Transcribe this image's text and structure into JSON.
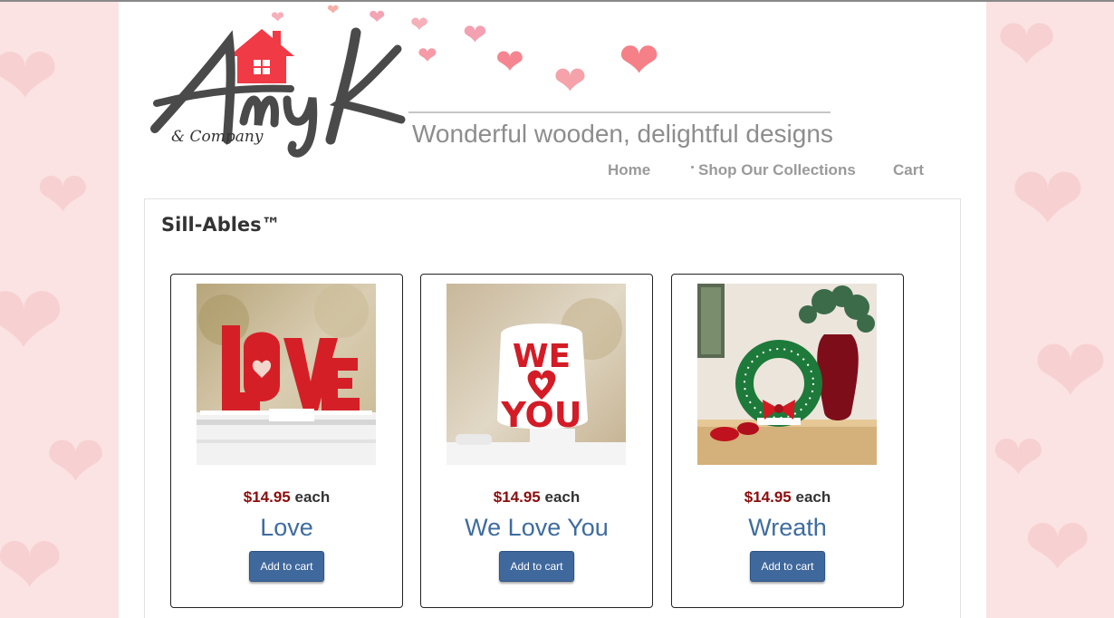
{
  "brand": {
    "logo_text": "Amy K",
    "logo_sub": "& Company",
    "tagline": "Wonderful wooden, delightful designs"
  },
  "nav": {
    "items": [
      "Home",
      "Shop Our Collections",
      "Cart"
    ]
  },
  "section": {
    "title": "Sill-Ables™"
  },
  "products": [
    {
      "price": "$14.95",
      "each": "each",
      "name": "Love",
      "button": "Add to cart",
      "image": "love-sign-image"
    },
    {
      "price": "$14.95",
      "each": "each",
      "name": "We Love You",
      "button": "Add to cart",
      "image": "we-love-you-sign-image"
    },
    {
      "price": "$14.95",
      "each": "each",
      "name": "Wreath",
      "button": "Add to cart",
      "image": "wreath-image"
    }
  ],
  "colors": {
    "accent_red": "#f03a45",
    "price_red": "#8b0d0d",
    "name_blue": "#3e6c9f",
    "button_blue": "#3f689d",
    "background_pink": "#fbe3e3"
  }
}
